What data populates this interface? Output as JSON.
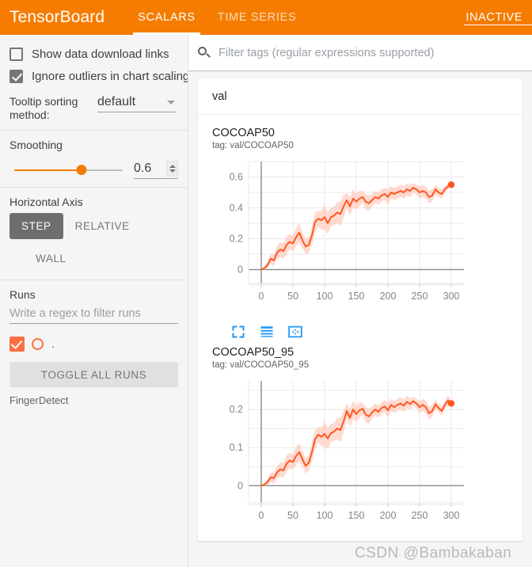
{
  "header": {
    "brand": "TensorBoard",
    "tabs": [
      {
        "label": "SCALARS",
        "active": true
      },
      {
        "label": "TIME SERIES",
        "active": false
      }
    ],
    "status": "INACTIVE",
    "accent_color": "#f57c00"
  },
  "sidebar": {
    "checkboxes": [
      {
        "label": "Show data download links",
        "checked": false
      },
      {
        "label": "Ignore outliers in chart scaling",
        "checked": true
      }
    ],
    "tooltip": {
      "label": "Tooltip sorting method:",
      "value": "default"
    },
    "smoothing": {
      "label": "Smoothing",
      "value": "0.6",
      "fraction": 0.62
    },
    "horizontal_axis": {
      "label": "Horizontal Axis",
      "options": [
        "STEP",
        "RELATIVE",
        "WALL"
      ],
      "selected": "STEP"
    },
    "runs": {
      "label": "Runs",
      "filter_placeholder": "Write a regex to filter runs",
      "current_run": ".",
      "toggle_label": "TOGGLE ALL RUNS",
      "legend": "FingerDetect",
      "run_color": "#ff6e42"
    }
  },
  "main": {
    "filter_placeholder": "Filter tags (regular expressions supported)",
    "group_label": "val",
    "tool_icons": [
      "expand-icon",
      "data-table-icon",
      "pan-icon"
    ],
    "series_color": "#ff5722",
    "band_color": "#ffc4b3"
  },
  "watermark": "CSDN @Bambakaban",
  "chart_data": [
    {
      "type": "line",
      "title": "COCOAP50",
      "tag": "tag: val/COCOAP50",
      "xlabel": "",
      "ylabel": "",
      "xlim": [
        -20,
        320
      ],
      "ylim": [
        -0.09,
        0.7
      ],
      "xticks": [
        0,
        50,
        100,
        150,
        200,
        250,
        300
      ],
      "yticks": [
        0,
        0.2,
        0.4,
        0.6
      ],
      "grid": true,
      "legend": "none",
      "series": [
        {
          "name": "FingerDetect",
          "x": [
            0,
            5,
            10,
            15,
            20,
            25,
            30,
            35,
            40,
            45,
            50,
            55,
            60,
            65,
            70,
            75,
            80,
            85,
            90,
            95,
            100,
            105,
            110,
            115,
            120,
            125,
            130,
            135,
            140,
            145,
            150,
            155,
            160,
            165,
            170,
            175,
            180,
            185,
            190,
            195,
            200,
            205,
            210,
            215,
            220,
            225,
            230,
            235,
            240,
            245,
            250,
            255,
            260,
            265,
            270,
            275,
            280,
            285,
            290,
            295,
            300
          ],
          "values": [
            0.0,
            0.01,
            0.03,
            0.07,
            0.06,
            0.11,
            0.13,
            0.12,
            0.16,
            0.18,
            0.17,
            0.21,
            0.24,
            0.19,
            0.15,
            0.16,
            0.22,
            0.31,
            0.33,
            0.32,
            0.34,
            0.3,
            0.34,
            0.35,
            0.37,
            0.36,
            0.41,
            0.45,
            0.41,
            0.46,
            0.44,
            0.46,
            0.47,
            0.44,
            0.43,
            0.45,
            0.47,
            0.46,
            0.48,
            0.49,
            0.47,
            0.5,
            0.49,
            0.5,
            0.51,
            0.5,
            0.52,
            0.51,
            0.53,
            0.52,
            0.5,
            0.51,
            0.5,
            0.47,
            0.48,
            0.52,
            0.5,
            0.49,
            0.52,
            0.54,
            0.55
          ],
          "band_half_width": [
            0.0,
            0.01,
            0.02,
            0.03,
            0.04,
            0.04,
            0.05,
            0.05,
            0.06,
            0.05,
            0.05,
            0.06,
            0.06,
            0.05,
            0.05,
            0.05,
            0.06,
            0.06,
            0.05,
            0.06,
            0.08,
            0.07,
            0.06,
            0.06,
            0.07,
            0.08,
            0.07,
            0.05,
            0.06,
            0.06,
            0.05,
            0.05,
            0.04,
            0.05,
            0.05,
            0.04,
            0.04,
            0.04,
            0.04,
            0.04,
            0.05,
            0.04,
            0.04,
            0.04,
            0.04,
            0.04,
            0.04,
            0.04,
            0.03,
            0.03,
            0.04,
            0.04,
            0.04,
            0.04,
            0.04,
            0.03,
            0.03,
            0.03,
            0.02,
            0.02,
            0.01
          ],
          "last_point": {
            "x": 300,
            "y": 0.55
          }
        }
      ]
    },
    {
      "type": "line",
      "title": "COCOAP50_95",
      "tag": "tag: val/COCOAP50_95",
      "xlabel": "",
      "ylabel": "",
      "xlim": [
        -20,
        320
      ],
      "ylim": [
        -0.045,
        0.275
      ],
      "xticks": [
        0,
        50,
        100,
        150,
        200,
        250,
        300
      ],
      "yticks": [
        0,
        0.1,
        0.2
      ],
      "grid": true,
      "legend": "none",
      "series": [
        {
          "name": "FingerDetect",
          "x": [
            0,
            5,
            10,
            15,
            20,
            25,
            30,
            35,
            40,
            45,
            50,
            55,
            60,
            65,
            70,
            75,
            80,
            85,
            90,
            95,
            100,
            105,
            110,
            115,
            120,
            125,
            130,
            135,
            140,
            145,
            150,
            155,
            160,
            165,
            170,
            175,
            180,
            185,
            190,
            195,
            200,
            205,
            210,
            215,
            220,
            225,
            230,
            235,
            240,
            245,
            250,
            255,
            260,
            265,
            270,
            275,
            280,
            285,
            290,
            295,
            300
          ],
          "values": [
            0.0,
            0.003,
            0.01,
            0.022,
            0.02,
            0.035,
            0.043,
            0.04,
            0.058,
            0.066,
            0.062,
            0.078,
            0.088,
            0.07,
            0.052,
            0.06,
            0.088,
            0.122,
            0.134,
            0.128,
            0.136,
            0.124,
            0.138,
            0.142,
            0.15,
            0.146,
            0.168,
            0.196,
            0.178,
            0.2,
            0.188,
            0.198,
            0.202,
            0.186,
            0.182,
            0.192,
            0.2,
            0.194,
            0.204,
            0.208,
            0.198,
            0.212,
            0.206,
            0.212,
            0.216,
            0.21,
            0.22,
            0.214,
            0.222,
            0.216,
            0.206,
            0.212,
            0.206,
            0.19,
            0.196,
            0.214,
            0.204,
            0.196,
            0.212,
            0.224,
            0.216
          ],
          "band_half_width": [
            0.0,
            0.004,
            0.008,
            0.012,
            0.015,
            0.016,
            0.019,
            0.019,
            0.022,
            0.02,
            0.02,
            0.024,
            0.024,
            0.02,
            0.02,
            0.02,
            0.024,
            0.024,
            0.02,
            0.024,
            0.032,
            0.028,
            0.024,
            0.024,
            0.028,
            0.032,
            0.028,
            0.02,
            0.024,
            0.024,
            0.02,
            0.02,
            0.016,
            0.02,
            0.02,
            0.016,
            0.016,
            0.016,
            0.016,
            0.016,
            0.02,
            0.016,
            0.016,
            0.016,
            0.016,
            0.016,
            0.016,
            0.016,
            0.012,
            0.012,
            0.016,
            0.016,
            0.016,
            0.016,
            0.016,
            0.012,
            0.012,
            0.012,
            0.01,
            0.014,
            0.006
          ],
          "last_point": {
            "x": 300,
            "y": 0.216
          }
        }
      ]
    }
  ]
}
